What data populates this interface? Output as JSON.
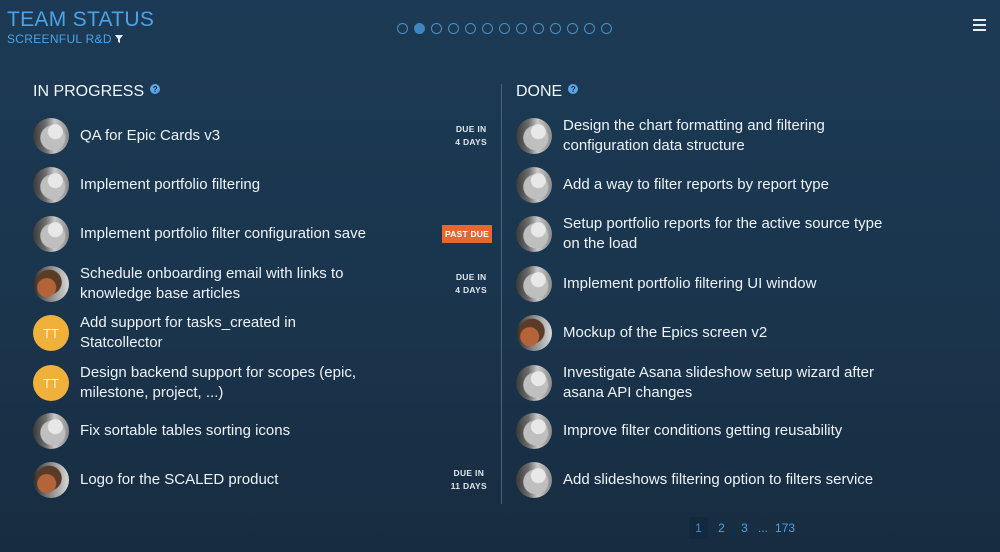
{
  "header": {
    "title": "TEAM STATUS",
    "subtitle": "SCREENFUL R&D"
  },
  "slides": {
    "count": 13,
    "active_index": 1
  },
  "in_progress": {
    "title": "IN PROGRESS",
    "tasks": [
      {
        "text": "QA for Epic Cards v3",
        "avatar": "photo-a",
        "due_line1": "DUE IN",
        "due_line2": "4 DAYS"
      },
      {
        "text": "Implement portfolio filtering",
        "avatar": "photo-a"
      },
      {
        "text": "Implement portfolio filter configuration save",
        "avatar": "photo-a",
        "status": "PAST DUE"
      },
      {
        "text": "Schedule onboarding email with links to knowledge base articles",
        "avatar": "photo-b",
        "due_line1": "DUE IN",
        "due_line2": "4 DAYS"
      },
      {
        "text": "Add support for tasks_created in Statcollector",
        "avatar": "initials",
        "initials": "TT"
      },
      {
        "text": "Design backend support for scopes (epic, milestone, project, ...)",
        "avatar": "initials",
        "initials": "TT"
      },
      {
        "text": "Fix sortable tables sorting icons",
        "avatar": "photo-a"
      },
      {
        "text": "Logo for the SCALED product",
        "avatar": "photo-b",
        "due_line1": "DUE IN",
        "due_line2": "11 DAYS"
      }
    ]
  },
  "done": {
    "title": "DONE",
    "tasks": [
      {
        "text": "Design the chart formatting and filtering configuration data structure",
        "avatar": "photo-a"
      },
      {
        "text": "Add a way to filter reports by report type",
        "avatar": "photo-a"
      },
      {
        "text": "Setup portfolio reports for the active source type on the load",
        "avatar": "photo-a"
      },
      {
        "text": "Implement portfolio filtering UI window",
        "avatar": "photo-a"
      },
      {
        "text": "Mockup of the Epics screen v2",
        "avatar": "photo-b"
      },
      {
        "text": "Investigate Asana slideshow setup wizard after asana API changes",
        "avatar": "photo-a"
      },
      {
        "text": "Improve filter conditions getting reusability",
        "avatar": "photo-a"
      },
      {
        "text": "Add slideshows filtering option to filters service",
        "avatar": "photo-a"
      }
    ]
  },
  "pagination": {
    "pages": [
      "1",
      "2",
      "3"
    ],
    "current": "1",
    "ellipsis": "...",
    "last": "173"
  },
  "colors": {
    "accent": "#4aa3e8",
    "past_due": "#e8672e",
    "initials_avatar": "#efb13b"
  },
  "icons": {
    "filter": "filter-icon",
    "help": "help-icon",
    "menu": "hamburger-menu-icon"
  }
}
